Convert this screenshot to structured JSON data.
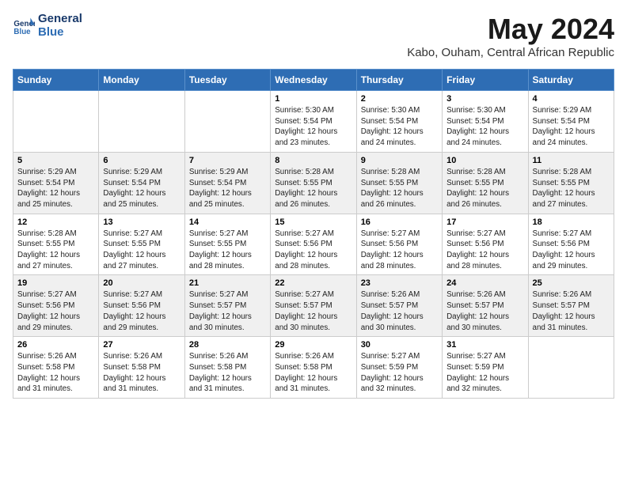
{
  "header": {
    "logo_line1": "General",
    "logo_line2": "Blue",
    "month_year": "May 2024",
    "subtitle": "Kabo, Ouham, Central African Republic"
  },
  "days_of_week": [
    "Sunday",
    "Monday",
    "Tuesday",
    "Wednesday",
    "Thursday",
    "Friday",
    "Saturday"
  ],
  "weeks": [
    [
      {
        "day": "",
        "text": ""
      },
      {
        "day": "",
        "text": ""
      },
      {
        "day": "",
        "text": ""
      },
      {
        "day": "1",
        "text": "Sunrise: 5:30 AM\nSunset: 5:54 PM\nDaylight: 12 hours\nand 23 minutes."
      },
      {
        "day": "2",
        "text": "Sunrise: 5:30 AM\nSunset: 5:54 PM\nDaylight: 12 hours\nand 24 minutes."
      },
      {
        "day": "3",
        "text": "Sunrise: 5:30 AM\nSunset: 5:54 PM\nDaylight: 12 hours\nand 24 minutes."
      },
      {
        "day": "4",
        "text": "Sunrise: 5:29 AM\nSunset: 5:54 PM\nDaylight: 12 hours\nand 24 minutes."
      }
    ],
    [
      {
        "day": "5",
        "text": "Sunrise: 5:29 AM\nSunset: 5:54 PM\nDaylight: 12 hours\nand 25 minutes."
      },
      {
        "day": "6",
        "text": "Sunrise: 5:29 AM\nSunset: 5:54 PM\nDaylight: 12 hours\nand 25 minutes."
      },
      {
        "day": "7",
        "text": "Sunrise: 5:29 AM\nSunset: 5:54 PM\nDaylight: 12 hours\nand 25 minutes."
      },
      {
        "day": "8",
        "text": "Sunrise: 5:28 AM\nSunset: 5:55 PM\nDaylight: 12 hours\nand 26 minutes."
      },
      {
        "day": "9",
        "text": "Sunrise: 5:28 AM\nSunset: 5:55 PM\nDaylight: 12 hours\nand 26 minutes."
      },
      {
        "day": "10",
        "text": "Sunrise: 5:28 AM\nSunset: 5:55 PM\nDaylight: 12 hours\nand 26 minutes."
      },
      {
        "day": "11",
        "text": "Sunrise: 5:28 AM\nSunset: 5:55 PM\nDaylight: 12 hours\nand 27 minutes."
      }
    ],
    [
      {
        "day": "12",
        "text": "Sunrise: 5:28 AM\nSunset: 5:55 PM\nDaylight: 12 hours\nand 27 minutes."
      },
      {
        "day": "13",
        "text": "Sunrise: 5:27 AM\nSunset: 5:55 PM\nDaylight: 12 hours\nand 27 minutes."
      },
      {
        "day": "14",
        "text": "Sunrise: 5:27 AM\nSunset: 5:55 PM\nDaylight: 12 hours\nand 28 minutes."
      },
      {
        "day": "15",
        "text": "Sunrise: 5:27 AM\nSunset: 5:56 PM\nDaylight: 12 hours\nand 28 minutes."
      },
      {
        "day": "16",
        "text": "Sunrise: 5:27 AM\nSunset: 5:56 PM\nDaylight: 12 hours\nand 28 minutes."
      },
      {
        "day": "17",
        "text": "Sunrise: 5:27 AM\nSunset: 5:56 PM\nDaylight: 12 hours\nand 28 minutes."
      },
      {
        "day": "18",
        "text": "Sunrise: 5:27 AM\nSunset: 5:56 PM\nDaylight: 12 hours\nand 29 minutes."
      }
    ],
    [
      {
        "day": "19",
        "text": "Sunrise: 5:27 AM\nSunset: 5:56 PM\nDaylight: 12 hours\nand 29 minutes."
      },
      {
        "day": "20",
        "text": "Sunrise: 5:27 AM\nSunset: 5:56 PM\nDaylight: 12 hours\nand 29 minutes."
      },
      {
        "day": "21",
        "text": "Sunrise: 5:27 AM\nSunset: 5:57 PM\nDaylight: 12 hours\nand 30 minutes."
      },
      {
        "day": "22",
        "text": "Sunrise: 5:27 AM\nSunset: 5:57 PM\nDaylight: 12 hours\nand 30 minutes."
      },
      {
        "day": "23",
        "text": "Sunrise: 5:26 AM\nSunset: 5:57 PM\nDaylight: 12 hours\nand 30 minutes."
      },
      {
        "day": "24",
        "text": "Sunrise: 5:26 AM\nSunset: 5:57 PM\nDaylight: 12 hours\nand 30 minutes."
      },
      {
        "day": "25",
        "text": "Sunrise: 5:26 AM\nSunset: 5:57 PM\nDaylight: 12 hours\nand 31 minutes."
      }
    ],
    [
      {
        "day": "26",
        "text": "Sunrise: 5:26 AM\nSunset: 5:58 PM\nDaylight: 12 hours\nand 31 minutes."
      },
      {
        "day": "27",
        "text": "Sunrise: 5:26 AM\nSunset: 5:58 PM\nDaylight: 12 hours\nand 31 minutes."
      },
      {
        "day": "28",
        "text": "Sunrise: 5:26 AM\nSunset: 5:58 PM\nDaylight: 12 hours\nand 31 minutes."
      },
      {
        "day": "29",
        "text": "Sunrise: 5:26 AM\nSunset: 5:58 PM\nDaylight: 12 hours\nand 31 minutes."
      },
      {
        "day": "30",
        "text": "Sunrise: 5:27 AM\nSunset: 5:59 PM\nDaylight: 12 hours\nand 32 minutes."
      },
      {
        "day": "31",
        "text": "Sunrise: 5:27 AM\nSunset: 5:59 PM\nDaylight: 12 hours\nand 32 minutes."
      },
      {
        "day": "",
        "text": ""
      }
    ]
  ]
}
